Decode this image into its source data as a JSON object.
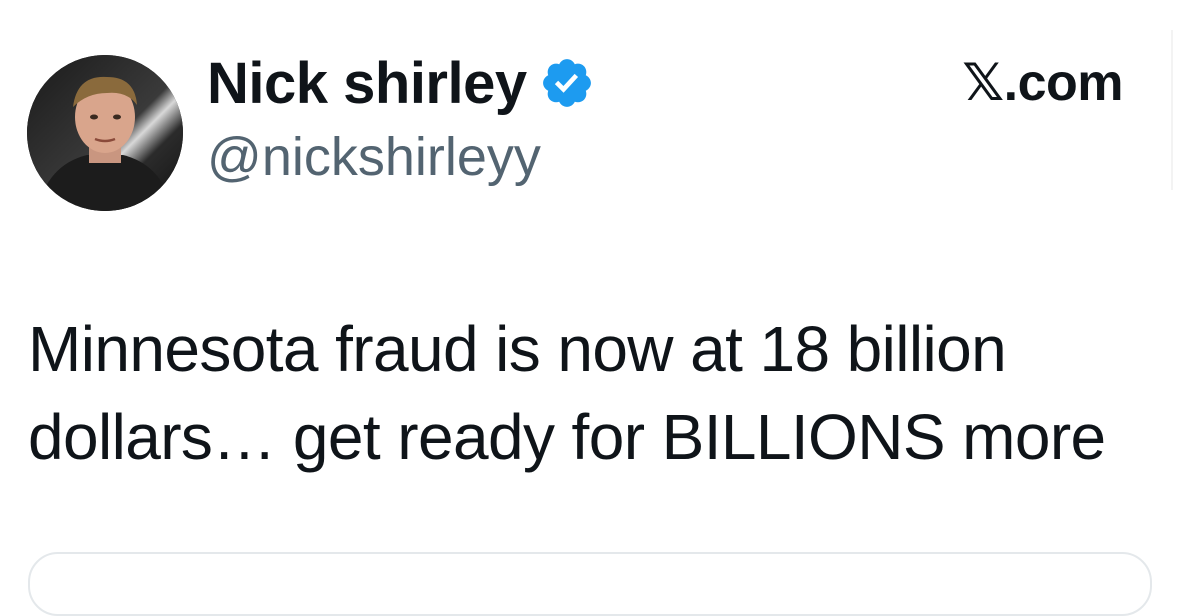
{
  "author": {
    "display_name": "Nick shirley",
    "handle": "@nickshirleyy",
    "verified": true,
    "avatar_icon": "profile-photo"
  },
  "source": {
    "label": "𝕏.com"
  },
  "tweet": {
    "lines": [
      "Minnesota fraud is now at 18 billion",
      "dollars… get ready for BILLIONS more"
    ]
  },
  "colors": {
    "text": "#0f1419",
    "handle": "#536471",
    "verified_badge": "#1d9bf0",
    "card_border": "#e4e8eb"
  }
}
